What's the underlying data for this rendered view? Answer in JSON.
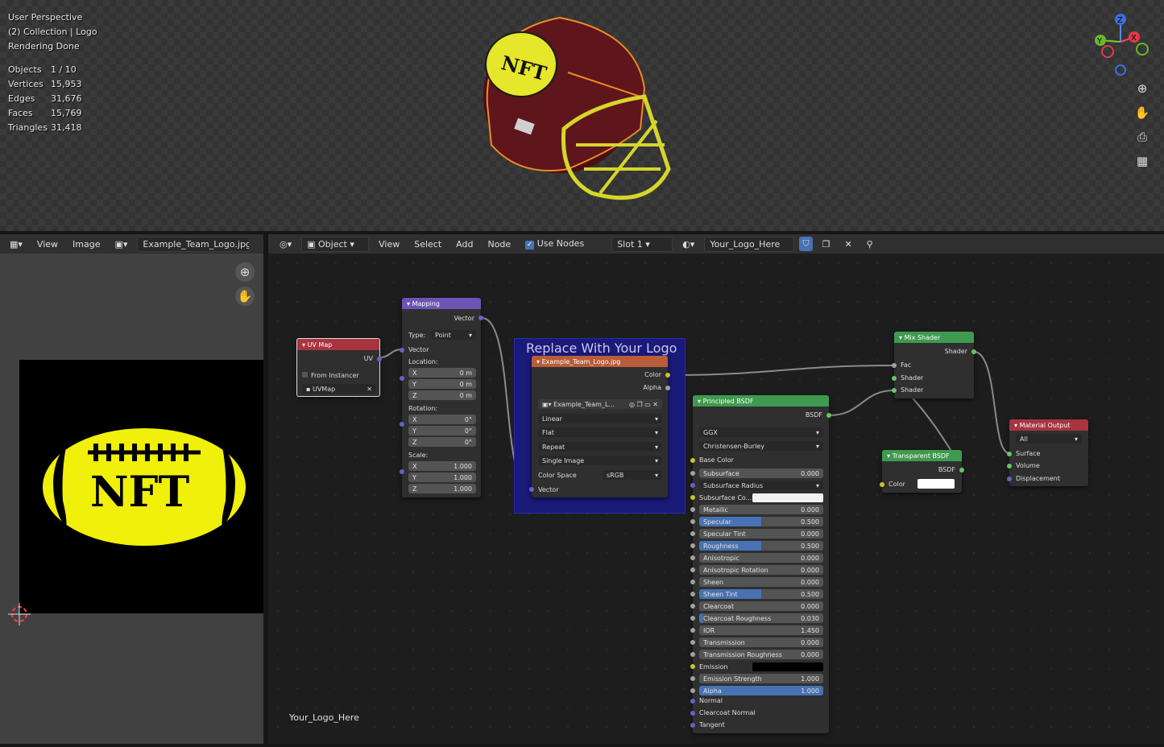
{
  "viewport": {
    "perspective": "User Perspective",
    "collection": "(2) Collection | Logo",
    "status": "Rendering Done",
    "stats": [
      {
        "label": "Objects",
        "value": "1 / 10"
      },
      {
        "label": "Vertices",
        "value": "15,953"
      },
      {
        "label": "Edges",
        "value": "31,676"
      },
      {
        "label": "Faces",
        "value": "15,769"
      },
      {
        "label": "Triangles",
        "value": "31,418"
      }
    ],
    "gizmo": {
      "z": "Z",
      "y": "Y",
      "x": "X"
    },
    "helmet_logo": "NFT"
  },
  "image_editor": {
    "menu_view": "View",
    "menu_image": "Image",
    "image_name": "Example_Team_Logo.jpg",
    "logo_text": "NFT"
  },
  "node_editor": {
    "object_mode": "Object",
    "menu_view": "View",
    "menu_select": "Select",
    "menu_add": "Add",
    "menu_node": "Node",
    "use_nodes": "Use Nodes",
    "slot": "Slot 1",
    "material": "Your_Logo_Here",
    "material_label": "Your_Logo_Here",
    "frame_label": "Replace With Your Logo",
    "uvmap": {
      "title": "UV Map",
      "out_uv": "UV",
      "from_instancer": "From Instancer",
      "uvmap": "UVMap"
    },
    "mapping": {
      "title": "Mapping",
      "out_vector": "Vector",
      "type_label": "Type:",
      "type_value": "Point",
      "in_vector": "Vector",
      "location": "Location:",
      "rotation": "Rotation:",
      "scale": "Scale:",
      "loc": [
        {
          "k": "X",
          "v": "0 m"
        },
        {
          "k": "Y",
          "v": "0 m"
        },
        {
          "k": "Z",
          "v": "0 m"
        }
      ],
      "rot": [
        {
          "k": "X",
          "v": "0°"
        },
        {
          "k": "Y",
          "v": "0°"
        },
        {
          "k": "Z",
          "v": "0°"
        }
      ],
      "scl": [
        {
          "k": "X",
          "v": "1.000"
        },
        {
          "k": "Y",
          "v": "1.000"
        },
        {
          "k": "Z",
          "v": "1.000"
        }
      ]
    },
    "image_tex": {
      "title": "Example_Team_Logo.jpg",
      "out_color": "Color",
      "out_alpha": "Alpha",
      "image": "Example_Team_L...",
      "interp": "Linear",
      "proj": "Flat",
      "ext": "Repeat",
      "source": "Single Image",
      "cs_label": "Color Space",
      "cs_value": "sRGB",
      "in_vector": "Vector"
    },
    "bsdf": {
      "title": "Principled BSDF",
      "out": "BSDF",
      "dist": "GGX",
      "sss": "Christensen-Burley",
      "base_color": "Base Color",
      "fields": [
        {
          "k": "Subsurface",
          "v": "0.000",
          "p": 0
        },
        {
          "k": "Subsurface Radius",
          "v": "",
          "p": 0,
          "drop": true
        },
        {
          "k": "Subsurface Co...",
          "v": "",
          "p": 0,
          "color": "#f2f2f2"
        },
        {
          "k": "Metallic",
          "v": "0.000",
          "p": 0
        },
        {
          "k": "Specular",
          "v": "0.500",
          "p": 0.5
        },
        {
          "k": "Specular Tint",
          "v": "0.000",
          "p": 0
        },
        {
          "k": "Roughness",
          "v": "0.500",
          "p": 0.5
        },
        {
          "k": "Anisotropic",
          "v": "0.000",
          "p": 0
        },
        {
          "k": "Anisotropic Rotation",
          "v": "0.000",
          "p": 0
        },
        {
          "k": "Sheen",
          "v": "0.000",
          "p": 0
        },
        {
          "k": "Sheen Tint",
          "v": "0.500",
          "p": 0.5
        },
        {
          "k": "Clearcoat",
          "v": "0.000",
          "p": 0
        },
        {
          "k": "Clearcoat Roughness",
          "v": "0.030",
          "p": 0.03
        },
        {
          "k": "IOR",
          "v": "1.450",
          "p": 0
        },
        {
          "k": "Transmission",
          "v": "0.000",
          "p": 0
        },
        {
          "k": "Transmission Roughness",
          "v": "0.000",
          "p": 0
        },
        {
          "k": "Emission",
          "v": "",
          "p": 0,
          "color": "#000000"
        },
        {
          "k": "Emission Strength",
          "v": "1.000",
          "p": 0
        },
        {
          "k": "Alpha",
          "v": "1.000",
          "p": 1
        }
      ],
      "normal": "Normal",
      "cc_normal": "Clearcoat Normal",
      "tangent": "Tangent"
    },
    "mix": {
      "title": "Mix Shader",
      "out": "Shader",
      "fac": "Fac",
      "sh1": "Shader",
      "sh2": "Shader"
    },
    "transparent": {
      "title": "Transparent BSDF",
      "out": "BSDF",
      "color": "Color"
    },
    "output": {
      "title": "Material Output",
      "target": "All",
      "surface": "Surface",
      "volume": "Volume",
      "displacement": "Displacement"
    }
  }
}
